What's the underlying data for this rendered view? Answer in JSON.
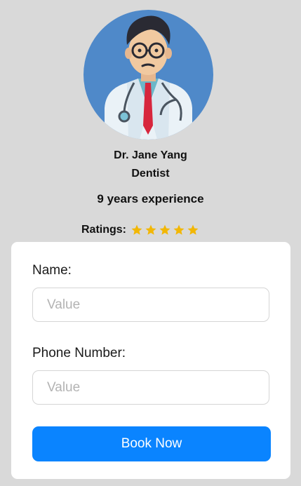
{
  "doctor": {
    "name": "Dr. Jane  Yang",
    "specialty": "Dentist",
    "experience": "9 years experience",
    "ratings_label": "Ratings:",
    "rating": 5,
    "rating_max": 5,
    "star_color": "#f2b705"
  },
  "form": {
    "name_label": "Name:",
    "name_placeholder": "Value",
    "name_value": "",
    "phone_label": "Phone Number:",
    "phone_placeholder": "Value",
    "phone_value": "",
    "submit_label": "Book Now"
  },
  "colors": {
    "background": "#d9d9d9",
    "card": "#ffffff",
    "accent": "#0a84ff",
    "avatar_bg": "#4f89c9"
  },
  "icons": {
    "avatar": "doctor-avatar",
    "star": "star-icon"
  }
}
